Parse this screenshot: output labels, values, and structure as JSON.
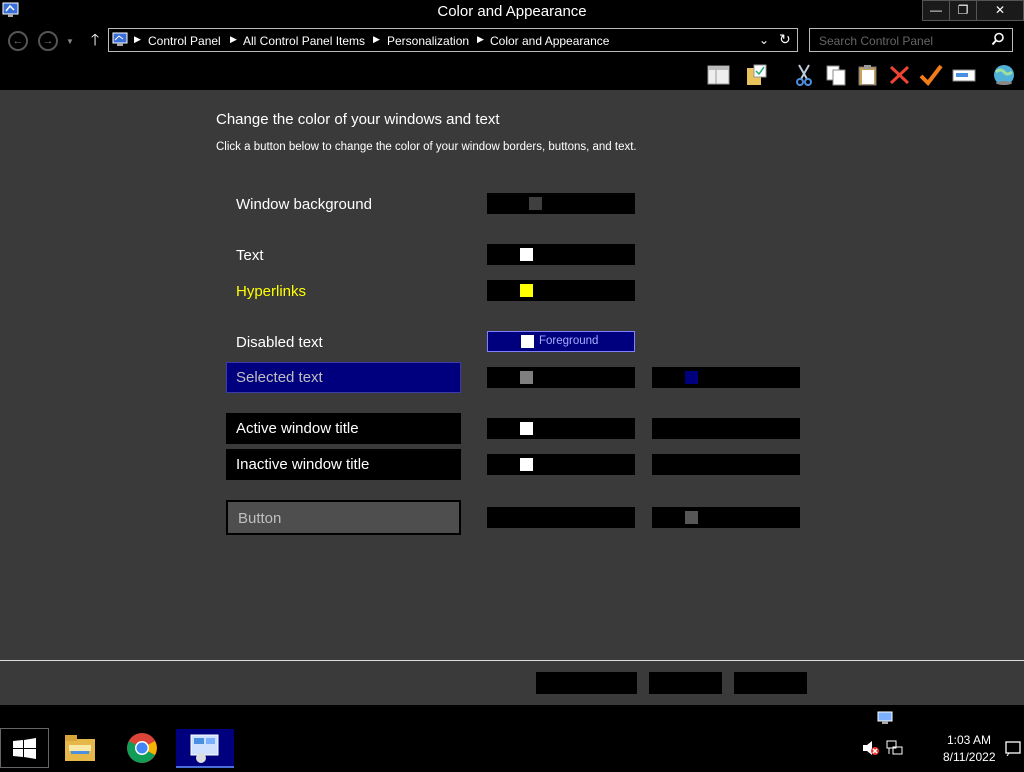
{
  "window": {
    "title": "Color and Appearance",
    "minimize_label": "—",
    "maximize_label": "❐",
    "close_label": "✕"
  },
  "address": {
    "breadcrumbs": [
      "Control Panel",
      "All Control Panel Items",
      "Personalization",
      "Color and Appearance"
    ],
    "search_placeholder": "Search Control Panel"
  },
  "toolbar": {
    "icons": [
      "layout-icon",
      "folder-check-icon",
      "cut-icon",
      "copy-icon",
      "paste-icon",
      "delete-icon",
      "checkmark-icon",
      "rename-icon",
      "globe-icon"
    ]
  },
  "content": {
    "heading": "Change the color of your windows and text",
    "subheading": "Click a button below to change the color of your window borders, buttons, and text.",
    "items": [
      {
        "label": "Window background",
        "color": "#ffffff"
      },
      {
        "label": "Text",
        "color": "#ffffff"
      },
      {
        "label": "Hyperlinks",
        "color": "#ffff00"
      },
      {
        "label": "Disabled text",
        "color": "#ffffff",
        "swatch_label": "Foreground"
      },
      {
        "label": "Selected text",
        "color": "#7f7f7f"
      },
      {
        "label": "Active window title",
        "color": "#ffffff"
      },
      {
        "label": "Inactive window title",
        "color": "#ffffff"
      },
      {
        "label": "Button",
        "color": "#7f7f7f"
      }
    ],
    "colors": {
      "window_background_chip": "#3f3f3f",
      "text_chip": "#ffffff",
      "hyperlink_chip": "#ffff00",
      "hyperlink_color": "#ffff00",
      "disabled_foreground_bg": "#00007f",
      "selected_bg": "#00007f",
      "selected_text": "#bfbfbf",
      "selected_chip_fg": "#7f7f7f",
      "selected_chip_bg": "#00007f",
      "button_face": "#4e4e4e",
      "button_chip_bg": "#575757",
      "content_bg": "#3a3a3a"
    }
  },
  "taskbar": {
    "apps": [
      "start-icon",
      "file-explorer-icon",
      "chrome-icon",
      "control-panel-icon"
    ],
    "time": "1:03 AM",
    "date": "8/11/2022"
  }
}
